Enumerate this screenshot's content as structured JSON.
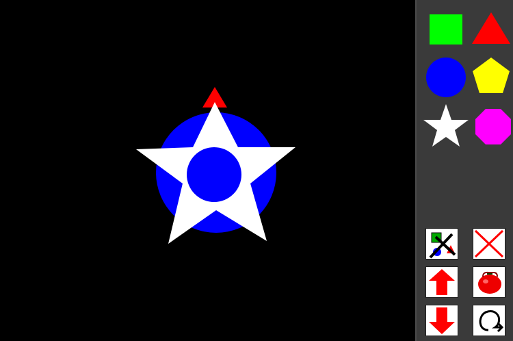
{
  "colors": {
    "canvas_background": "#000000",
    "palette_background": "#3a3a3a",
    "green": "#00ff00",
    "red": "#ff0000",
    "blue": "#0000ff",
    "yellow": "#ffff00",
    "white": "#ffffff",
    "magenta": "#ff00ff",
    "button_background": "#ffffff"
  },
  "canvas": {
    "shapes": [
      {
        "kind": "circle",
        "color": "blue"
      },
      {
        "kind": "triangle",
        "color": "red"
      },
      {
        "kind": "star",
        "color": "white"
      },
      {
        "kind": "circle",
        "color": "blue"
      }
    ]
  },
  "palette": {
    "shapes": [
      {
        "kind": "square",
        "color": "green"
      },
      {
        "kind": "triangle",
        "color": "red"
      },
      {
        "kind": "circle",
        "color": "blue"
      },
      {
        "kind": "pentagon",
        "color": "yellow"
      },
      {
        "kind": "star",
        "color": "white"
      },
      {
        "kind": "octagon",
        "color": "magenta"
      }
    ]
  },
  "toolbar": {
    "buttons": [
      {
        "action": "clear-shapes",
        "icon": "clear-shapes-icon"
      },
      {
        "action": "delete",
        "icon": "red-x-icon"
      },
      {
        "action": "move-up",
        "icon": "up-arrow-icon"
      },
      {
        "action": "save",
        "icon": "tomato-icon"
      },
      {
        "action": "move-down",
        "icon": "down-arrow-icon"
      },
      {
        "action": "restart",
        "icon": "restart-icon"
      }
    ]
  }
}
